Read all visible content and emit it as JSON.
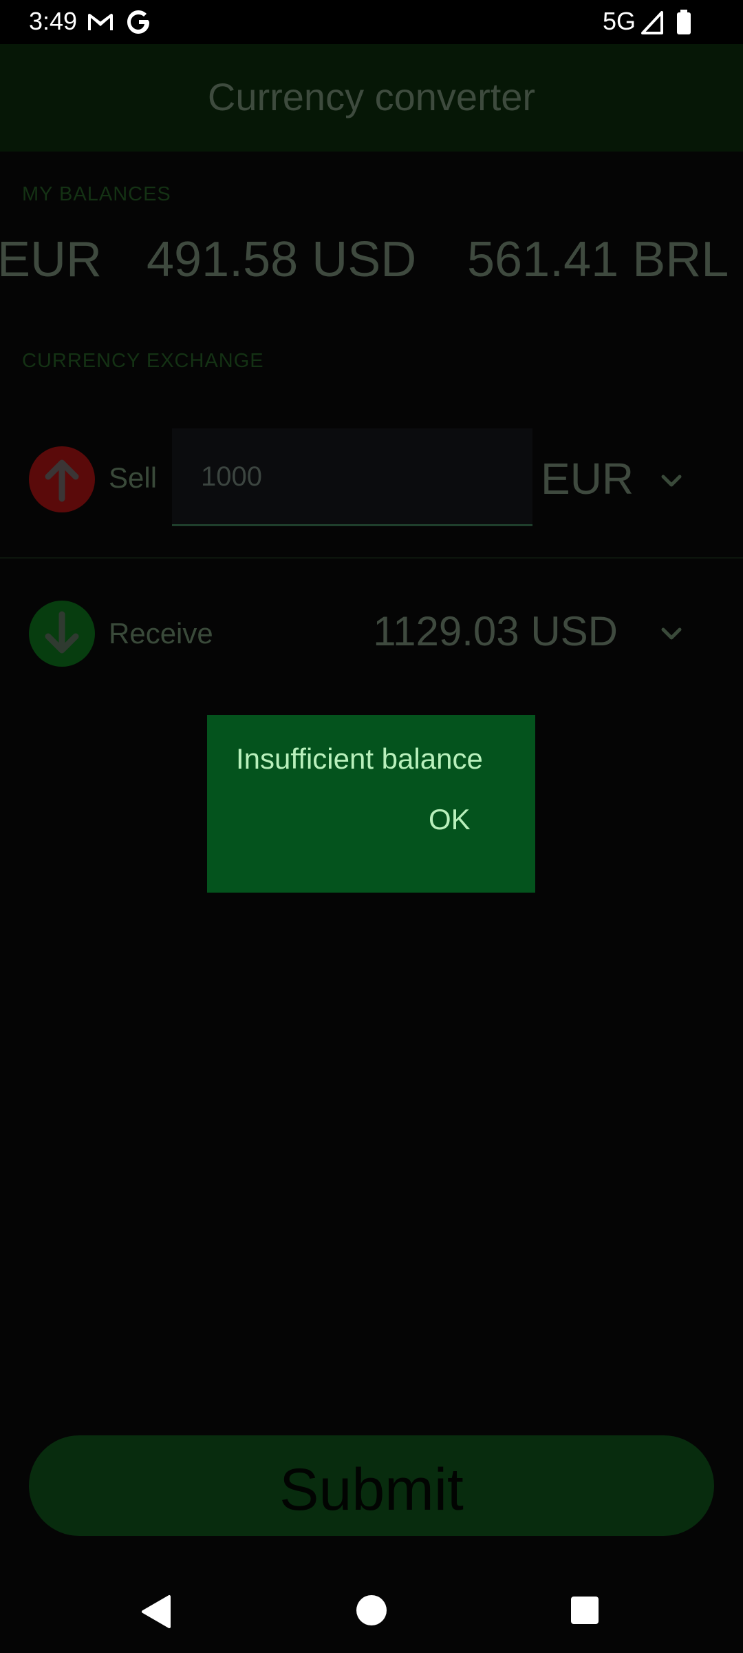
{
  "status_bar": {
    "time": "3:49",
    "network": "5G",
    "icons": [
      "gmail-icon",
      "google-icon",
      "signal-icon",
      "battery-icon"
    ]
  },
  "app_bar": {
    "title": "Currency converter"
  },
  "balances": {
    "section_label": "MY BALANCES",
    "items": [
      "EUR",
      "491.58 USD",
      "561.41 BRL"
    ]
  },
  "exchange": {
    "section_label": "CURRENCY EXCHANGE",
    "sell": {
      "label": "Sell",
      "amount": "1000",
      "currency": "EUR",
      "icon": "arrow-up-icon",
      "icon_color": "#5a0a0a"
    },
    "receive": {
      "label": "Receive",
      "amount": "1129.03 USD",
      "icon": "arrow-down-icon",
      "icon_color": "#073d0f"
    }
  },
  "dialog": {
    "message": "Insufficient balance",
    "ok_label": "OK",
    "background": "#04531d",
    "text_color": "#b9f0bc"
  },
  "submit": {
    "label": "Submit"
  },
  "navigation": {
    "icons": [
      "back-icon",
      "home-icon",
      "recents-icon"
    ]
  }
}
